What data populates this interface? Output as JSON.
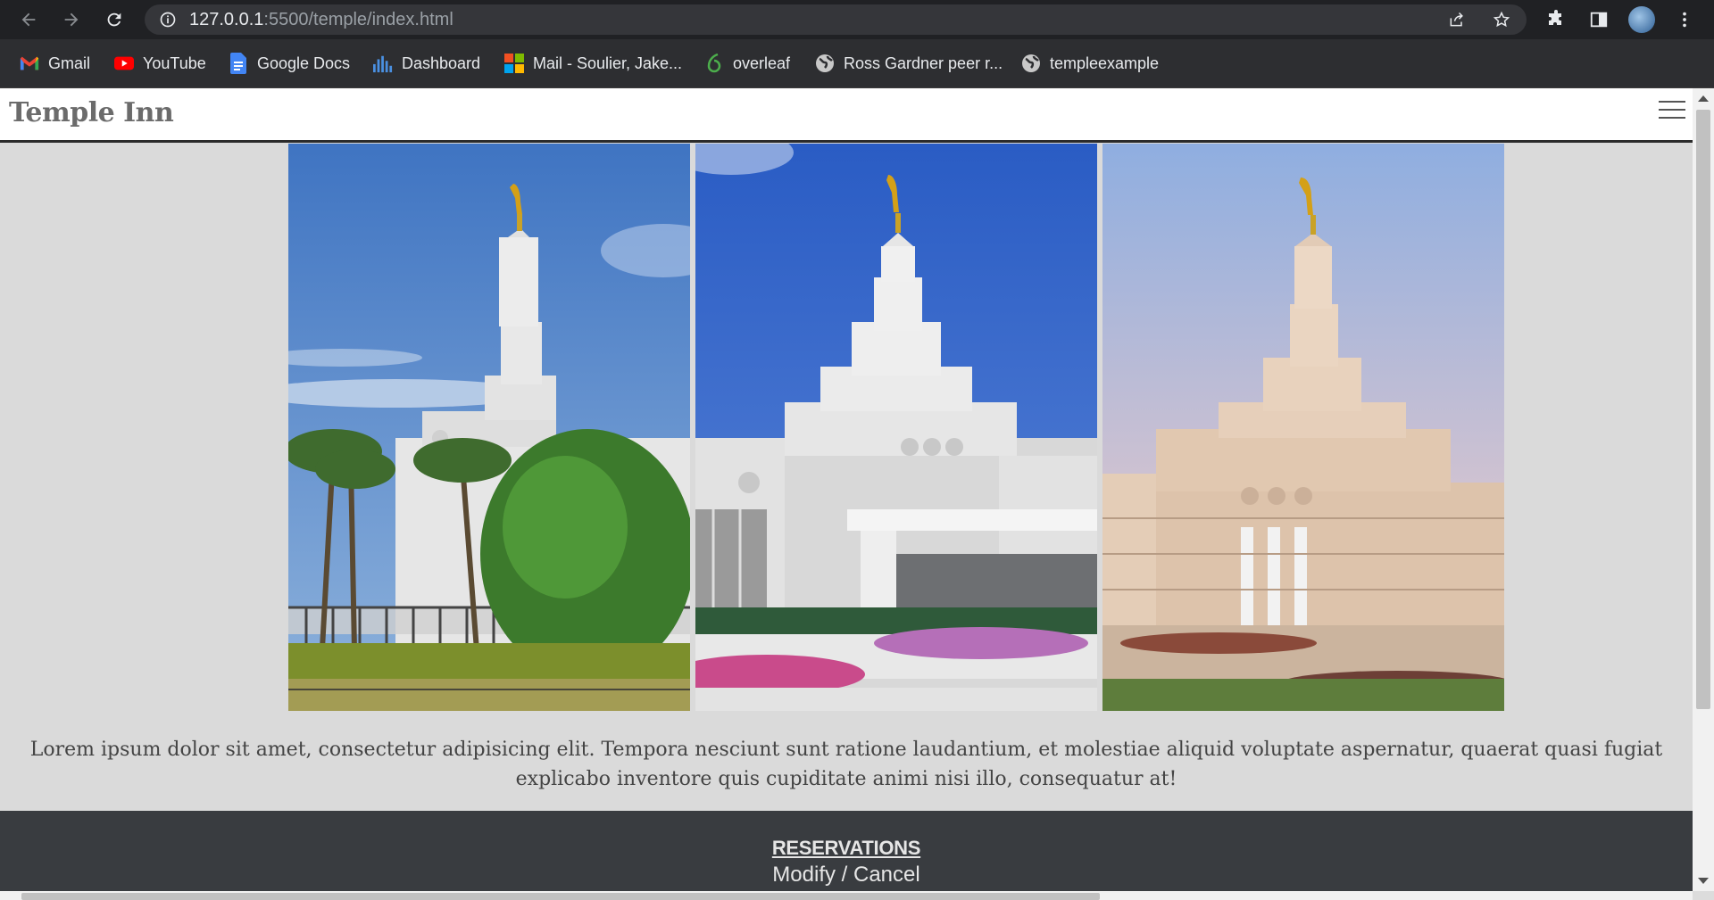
{
  "browser": {
    "url_host": "127.0.0.1",
    "url_path": ":5500/temple/index.html",
    "bookmarks": [
      {
        "label": "Gmail",
        "icon": "gmail-icon"
      },
      {
        "label": "YouTube",
        "icon": "youtube-icon"
      },
      {
        "label": "Google Docs",
        "icon": "docs-icon"
      },
      {
        "label": "Dashboard",
        "icon": "dashboard-icon"
      },
      {
        "label": "Mail - Soulier, Jake...",
        "icon": "microsoft-icon"
      },
      {
        "label": "overleaf",
        "icon": "overleaf-icon"
      },
      {
        "label": "Ross Gardner peer r...",
        "icon": "globe-icon"
      },
      {
        "label": "templeexample",
        "icon": "globe-icon"
      }
    ],
    "colors": {
      "toolbar": "#202124",
      "bookmarks_bar": "#2d2e31",
      "omnibox": "#35363a"
    }
  },
  "site": {
    "title": "Temple Inn",
    "lorem": "Lorem ipsum dolor sit amet, consectetur adipisicing elit. Tempora nesciunt sunt ratione laudantium, et molestiae aliquid voluptate aspernatur, quaerat quasi fugiat explicabo inventore quis cupiditate animi nisi illo, consequatur at!",
    "footer": {
      "reservations": "RESERVATIONS",
      "modify_cancel": "Modify / Cancel"
    },
    "colors": {
      "footer_bg": "#393c40",
      "page_bg": "#dadada"
    }
  }
}
